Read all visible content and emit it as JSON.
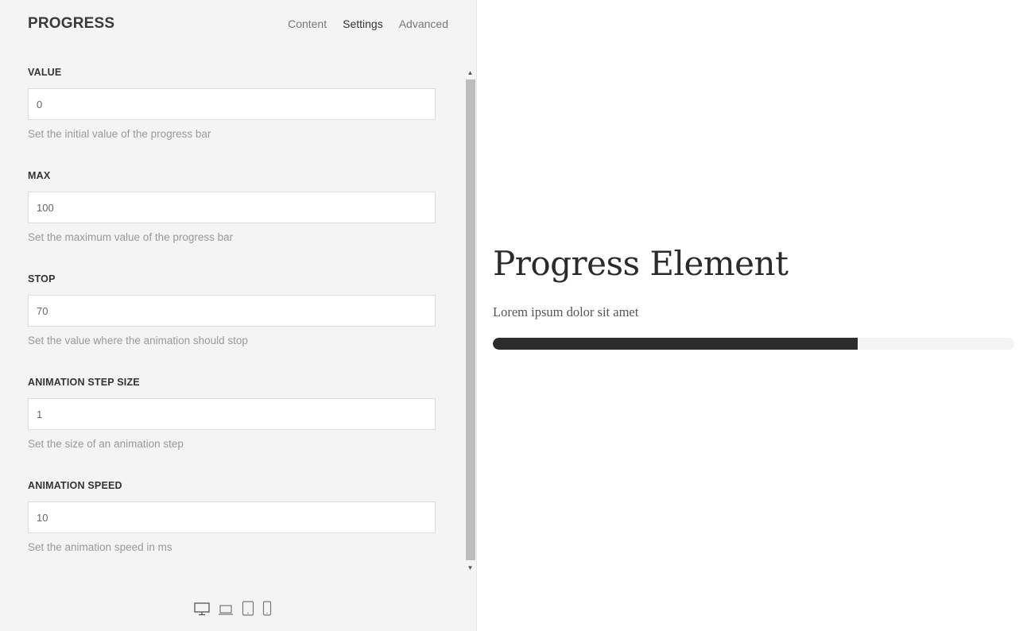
{
  "panel": {
    "title": "PROGRESS",
    "tabs": [
      {
        "label": "Content",
        "active": false
      },
      {
        "label": "Settings",
        "active": true
      },
      {
        "label": "Advanced",
        "active": false
      }
    ],
    "fields": [
      {
        "label": "VALUE",
        "value": "0",
        "help": "Set the initial value of the progress bar"
      },
      {
        "label": "MAX",
        "value": "100",
        "help": "Set the maximum value of the progress bar"
      },
      {
        "label": "STOP",
        "value": "70",
        "help": "Set the value where the animation should stop"
      },
      {
        "label": "ANIMATION STEP SIZE",
        "value": "1",
        "help": "Set the size of an animation step"
      },
      {
        "label": "ANIMATION SPEED",
        "value": "10",
        "help": "Set the animation speed in ms"
      }
    ],
    "devices": [
      "desktop-icon",
      "laptop-icon",
      "tablet-icon",
      "phone-icon"
    ]
  },
  "preview": {
    "title": "Progress Element",
    "text": "Lorem ipsum dolor sit amet",
    "progress_percent": 70
  },
  "colors": {
    "panel_bg": "#f4f4f4",
    "progress_fill": "#2c2c2c",
    "progress_track": "#f3f3f3"
  }
}
